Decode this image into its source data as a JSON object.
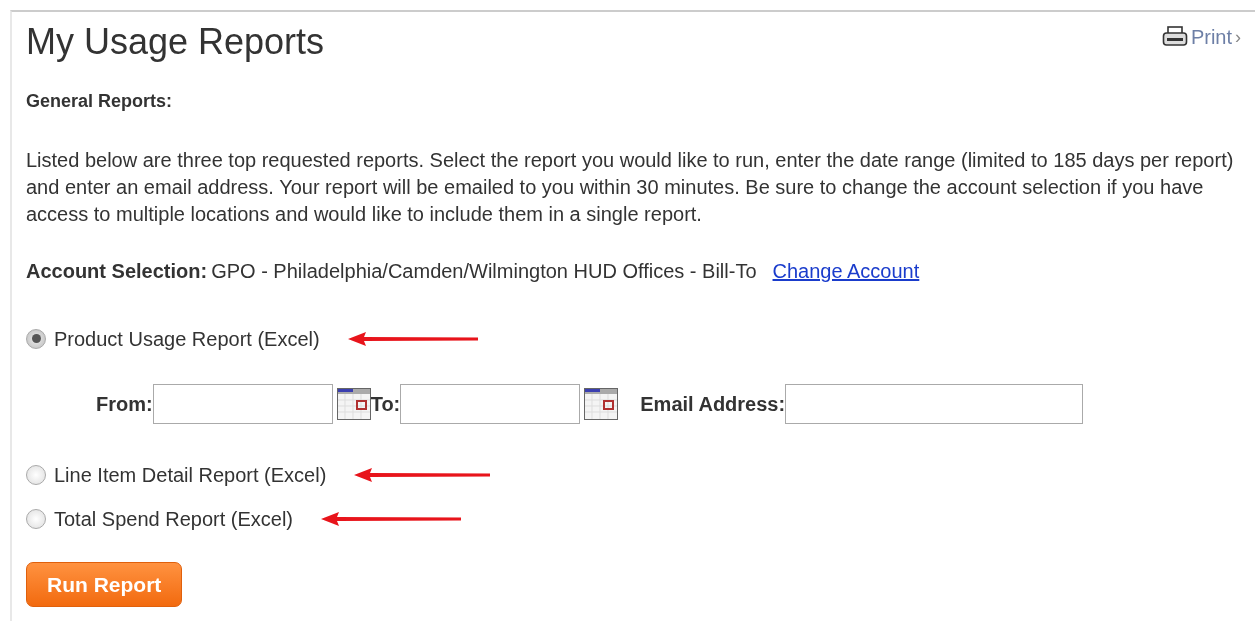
{
  "title": "My Usage Reports",
  "print": {
    "label": "Print",
    "chevron": "›"
  },
  "section_heading": "General Reports:",
  "description": "Listed below are three top requested reports. Select the report you would like to run, enter the date range (limited to 185 days per report) and enter an email address. Your report will be emailed to you within 30 minutes. Be sure to change the account selection if you have access to multiple locations and would like to include them in a single report.",
  "account": {
    "label": "Account Selection:",
    "value": "GPO - Philadelphia/Camden/Wilmington HUD Offices - Bill-To",
    "link": "Change Account"
  },
  "reports": [
    {
      "label": "Product Usage Report (Excel)",
      "selected": true,
      "fields": [
        {
          "label": "From:",
          "kind": "date"
        },
        {
          "label": "To:",
          "kind": "date"
        },
        {
          "label": "Email Address:",
          "kind": "email"
        }
      ]
    },
    {
      "label": "Line Item Detail Report (Excel)",
      "selected": false
    },
    {
      "label": "Total Spend Report (Excel)",
      "selected": false
    }
  ],
  "run_button": "Run Report"
}
